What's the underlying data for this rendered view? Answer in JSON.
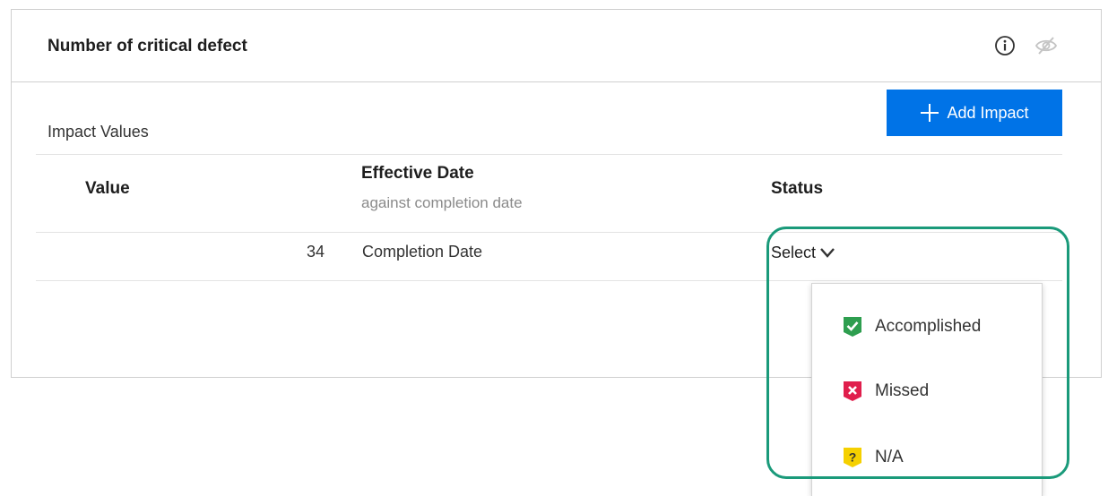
{
  "panel": {
    "title": "Number of critical defect",
    "icons": {
      "info": "info-circle-icon",
      "visibility": "eye-slash-icon"
    }
  },
  "impact": {
    "label": "Impact Values",
    "add_button_label": "Add Impact",
    "add_button_icon": "plus-icon"
  },
  "table": {
    "columns": {
      "value": "Value",
      "effective_date": "Effective Date",
      "effective_date_sub": "against completion date",
      "status": "Status"
    },
    "rows": [
      {
        "value": "34",
        "effective_date": "Completion Date",
        "status": "Select"
      }
    ]
  },
  "status_dropdown": {
    "options": [
      {
        "label": "Accomplished",
        "icon": "check-shield-icon",
        "color": "#2e9e4f"
      },
      {
        "label": "Missed",
        "icon": "x-shield-icon",
        "color": "#e01e4c"
      },
      {
        "label": "N/A",
        "icon": "question-shield-icon",
        "color": "#f5d000"
      }
    ]
  },
  "colors": {
    "accent": "#0073e7",
    "highlight": "#1a9a7a"
  }
}
